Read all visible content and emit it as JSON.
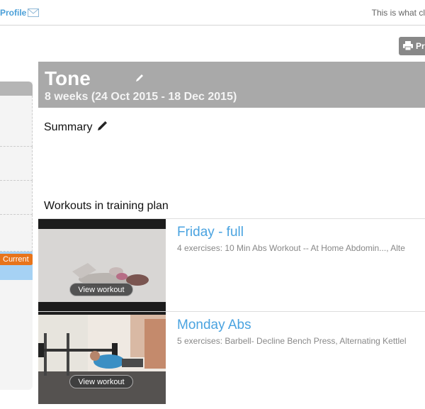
{
  "topbar": {
    "profile_label": "Profile",
    "hint_text": "This is what cl"
  },
  "toolbar": {
    "print_label": "Pri"
  },
  "sidebar": {
    "current_badge": "Current"
  },
  "plan": {
    "title": "Tone",
    "dates": "8 weeks (24 Oct 2015 - 18 Dec 2015)",
    "summary_label": "Summary"
  },
  "workouts": {
    "heading": "Workouts in training plan",
    "items": [
      {
        "title": "Friday - full",
        "description": "4 exercises: 10 Min Abs Workout -- At Home Abdomin..., Alte",
        "button_label": "View workout"
      },
      {
        "title": "Monday Abs",
        "description": "5 exercises: Barbell- Decline Bench Press, Alternating Kettlel",
        "button_label": "View workout"
      }
    ]
  },
  "colors": {
    "accent": "#4aa3e0",
    "header_bg": "#a9a9a9",
    "current_badge": "#e8741a",
    "current_row": "#a6d2f4"
  },
  "icons": [
    "mail-icon",
    "printer-icon",
    "pencil-icon"
  ]
}
